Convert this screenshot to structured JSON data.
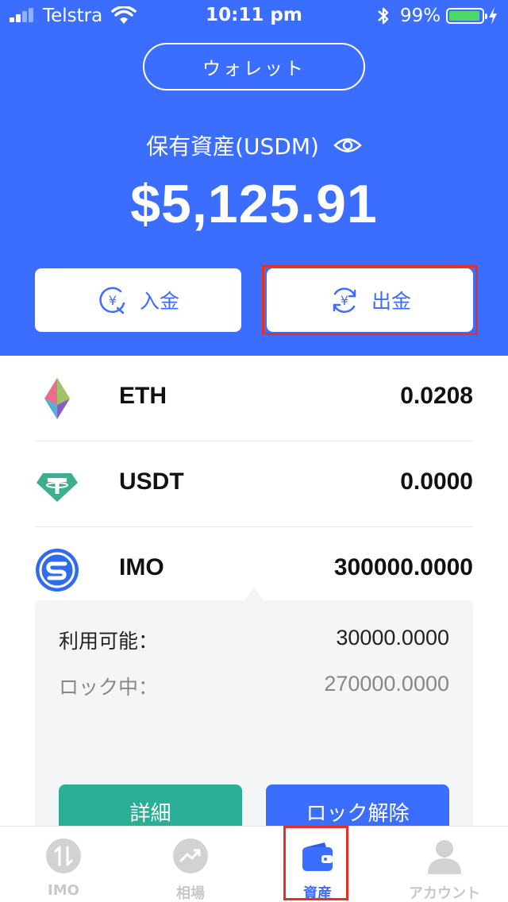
{
  "status_bar": {
    "carrier": "Telstra",
    "time": "10:11 pm",
    "battery_percent": "99%",
    "battery_level": 0.99,
    "signal_icon": "cell-signal-icon",
    "wifi_icon": "wifi-icon",
    "bluetooth_icon": "bluetooth-icon"
  },
  "header": {
    "wallet_button": "ウォレット",
    "holdings_label": "保有資産(USDM)",
    "balance": "$5,125.91",
    "deposit_label": "入金",
    "withdraw_label": "出金",
    "background_color": "#3B6DFE"
  },
  "assets": [
    {
      "name": "ETH",
      "amount": "0.0208",
      "icon": "ethereum-icon"
    },
    {
      "name": "USDT",
      "amount": "0.0000",
      "icon": "tether-icon"
    },
    {
      "name": "IMO",
      "amount": "300000.0000",
      "icon": "imo-icon"
    }
  ],
  "imo_detail": {
    "available_label": "利用可能：",
    "available_value": "30000.0000",
    "locked_label": "ロック中：",
    "locked_value": "270000.0000",
    "details_button": "詳細",
    "unlock_button": "ロック解除"
  },
  "tabbar": {
    "tabs": [
      {
        "label": "IMO",
        "icon": "transfer-icon",
        "active": false
      },
      {
        "label": "相場",
        "icon": "trend-icon",
        "active": false
      },
      {
        "label": "資産",
        "icon": "wallet-icon",
        "active": true
      },
      {
        "label": "アカウント",
        "icon": "user-icon",
        "active": false
      }
    ]
  },
  "colors": {
    "primary": "#3B6DFE",
    "accent_green": "#2BAE96",
    "highlight": "#E53121"
  }
}
